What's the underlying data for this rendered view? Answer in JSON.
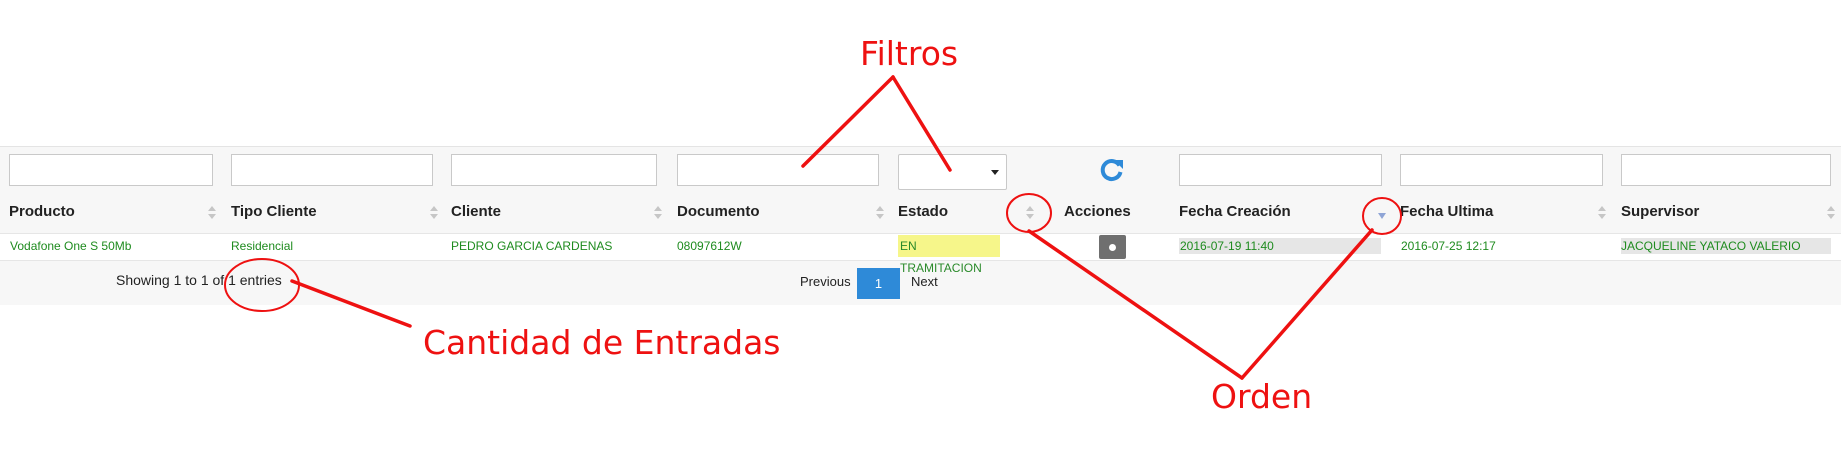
{
  "table": {
    "columns": [
      {
        "label": "Producto"
      },
      {
        "label": "Tipo Cliente"
      },
      {
        "label": "Cliente"
      },
      {
        "label": "Documento"
      },
      {
        "label": "Estado"
      },
      {
        "label": "Acciones"
      },
      {
        "label": "Fecha Creación"
      },
      {
        "label": "Fecha Ultima"
      },
      {
        "label": "Supervisor"
      }
    ],
    "sort": {
      "active_column": "Fecha Creación",
      "direction": "descending"
    },
    "rows": [
      {
        "producto": "Vodafone One S 50Mb",
        "tipo_cliente": "Residencial",
        "cliente": "PEDRO GARCIA CARDENAS",
        "documento": "08097612W",
        "estado": "EN TRAMITACION",
        "fecha_creacion": "2016-07-19 11:40",
        "fecha_ultima": "2016-07-25 12:17",
        "supervisor": "JACQUELINE YATACO VALERIO"
      }
    ]
  },
  "footer": {
    "info": "Showing 1 to 1 of 1 entries",
    "previous": "Previous",
    "current_page": "1",
    "next": "Next"
  },
  "annotations": {
    "filtros": "Filtros",
    "cantidad": "Cantidad de Entradas",
    "orden": "Orden"
  },
  "colors": {
    "annotation": "#ee1111",
    "cell_text": "#1e8b1e",
    "estado_badge": "#f6f68a",
    "pager_active": "#2e8ad8",
    "refresh_icon": "#2e8ad8"
  },
  "icons": [
    "refresh-icon",
    "sort-icon",
    "sort-desc-icon",
    "caret-down-icon",
    "action-dot-icon"
  ]
}
